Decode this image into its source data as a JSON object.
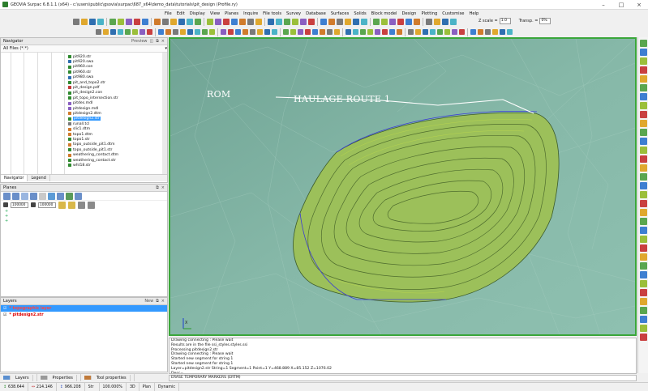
{
  "window": {
    "title": "GEOVIA Surpac 6.8.1.1 (x64) - c:\\users\\public\\gsovia\\surpac\\687_x64\\demo_data\\tutorials\\pit_design (Profile.ry)"
  },
  "menu": [
    "File",
    "Edit",
    "Display",
    "View",
    "Planes",
    "Inquire",
    "File tools",
    "Survey",
    "Database",
    "Surfaces",
    "Solids",
    "Block model",
    "Design",
    "Plotting",
    "Customise",
    "Help"
  ],
  "toolbar": {
    "z_scale_label": "Z scale =",
    "z_scale_value": "1.0",
    "transp_label": "Transp. =",
    "transp_value": "0%"
  },
  "navigator": {
    "title": "Navigator",
    "preview_label": "Preview",
    "filter": "All Files (*.*)",
    "files": [
      {
        "name": "pit920.str",
        "type": "str"
      },
      {
        "name": "pit920.swa",
        "type": "swa"
      },
      {
        "name": "pit960.con",
        "type": "con"
      },
      {
        "name": "pit960.str",
        "type": "str"
      },
      {
        "name": "pit980.swa",
        "type": "swa"
      },
      {
        "name": "pit_and_topo2.str",
        "type": "str"
      },
      {
        "name": "pit_design.pdf",
        "type": "pdf"
      },
      {
        "name": "pit_design2.con",
        "type": "con"
      },
      {
        "name": "pit_topo_intersection.str",
        "type": "str"
      },
      {
        "name": "pitdes.mdl",
        "type": "mdl"
      },
      {
        "name": "pitdesign.mdl",
        "type": "mdl"
      },
      {
        "name": "pitdesign2.dtm",
        "type": "dtm"
      },
      {
        "name": "pitdesign2.str",
        "type": "str",
        "selected": true
      },
      {
        "name": "runall.tcl",
        "type": "tcl"
      },
      {
        "name": "slic1.dtm",
        "type": "dtm"
      },
      {
        "name": "topo1.dtm",
        "type": "dtm"
      },
      {
        "name": "topo1.str",
        "type": "str"
      },
      {
        "name": "topo_outside_pit1.dtm",
        "type": "dtm"
      },
      {
        "name": "topo_outside_pit1.str",
        "type": "str"
      },
      {
        "name": "weathering_contact.dtm",
        "type": "dtm"
      },
      {
        "name": "weathering_contact.str",
        "type": "str"
      },
      {
        "name": "wht18.str",
        "type": "str"
      }
    ],
    "tabs": [
      "Navigator",
      "Legend"
    ]
  },
  "planes": {
    "title": "Planes",
    "input1": "100000",
    "input2": "100000",
    "tree": [
      "+",
      "+",
      "+"
    ]
  },
  "layers": {
    "title": "Layers",
    "new_label": "New",
    "items": [
      {
        "name": "* topographic layer",
        "selected": true
      },
      {
        "name": "* pitdesign2.str",
        "selected": false
      }
    ]
  },
  "bottom_tabs": [
    "Layers",
    "Properties",
    "Tool properties"
  ],
  "viewport": {
    "labels": [
      "ROM",
      "HAULAGE ROUTE 1"
    ],
    "axis_label": "X"
  },
  "console": {
    "lines": [
      "Drawing connecting : Please wait",
      "Results are in the file ssi_styles.styles.ssi",
      "Processing pitdesign2.str",
      "Drawing connecting : Please wait",
      "Started new segment for string 1",
      "Started new segment for string 1",
      "Layer=pitdesign2.str String=1 Segment=1 Point=1 Y=468.889 X=85.152 Z=1076.02",
      "Desc="
    ],
    "command": "ERASE TEMPORARY MARKERS (ERTM)"
  },
  "status": {
    "y": "638.644",
    "x": "214.146",
    "z": "966.208",
    "str": "",
    "zoom": "100.000%",
    "mode3d": "3D",
    "view": "Plan",
    "dynamic": "Dynamic"
  },
  "colors": {
    "terrain": "#7fb2a2",
    "pit": "#9cc05a",
    "frame": "#3aa63a",
    "selection": "#3399ff",
    "layer_name": "#dd0000"
  }
}
